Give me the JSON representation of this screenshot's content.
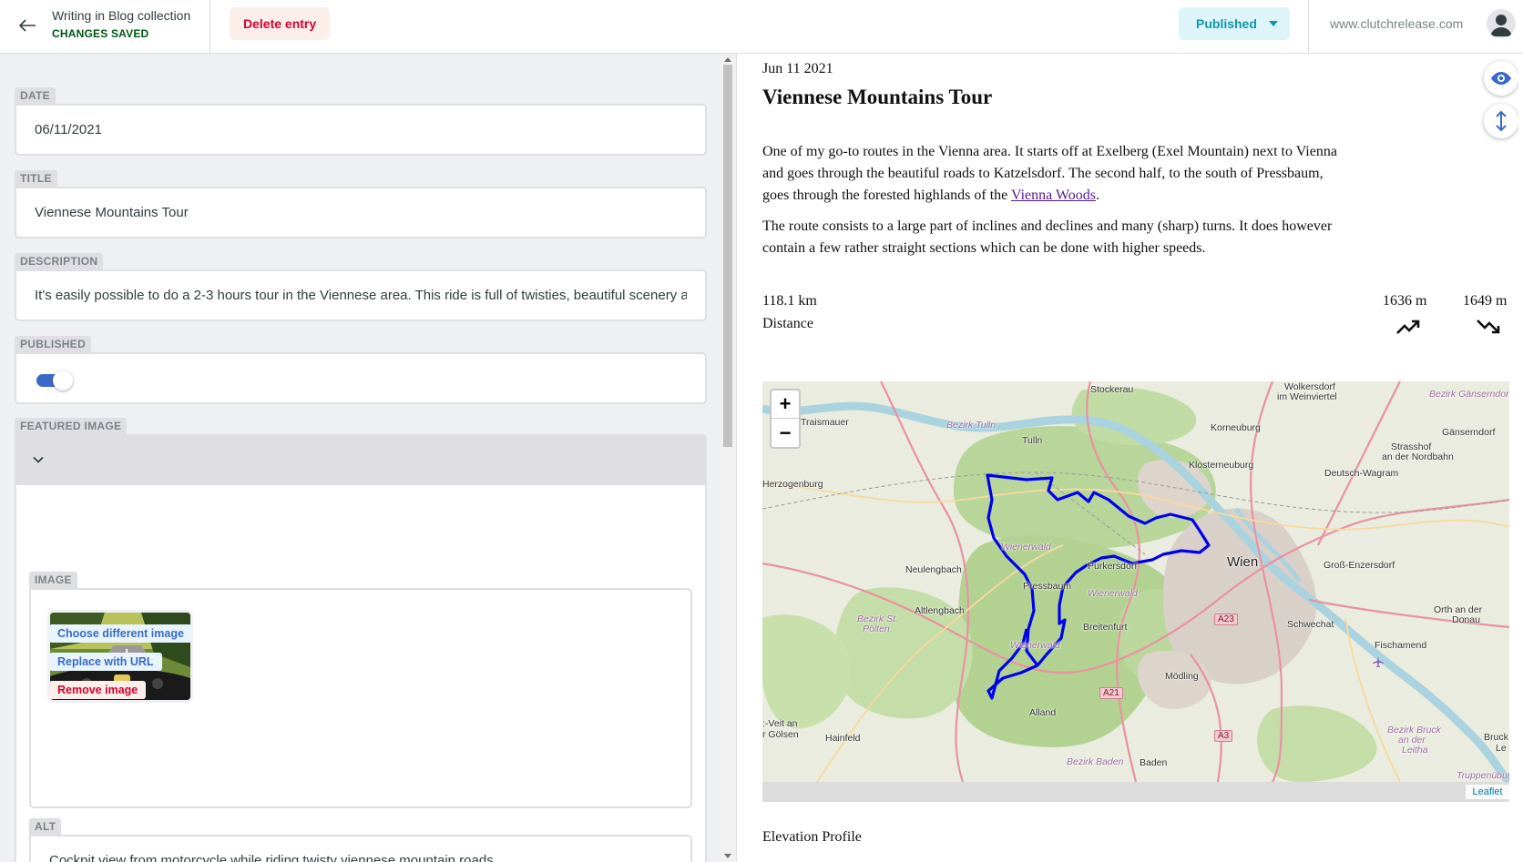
{
  "header": {
    "collection_title": "Writing in Blog collection",
    "save_status": "CHANGES SAVED",
    "delete_label": "Delete entry",
    "status_label": "Published",
    "site_url": "www.clutchrelease.com"
  },
  "fields": {
    "date": {
      "label": "DATE",
      "value": "06/11/2021"
    },
    "title": {
      "label": "TITLE",
      "value": "Viennese Mountains Tour"
    },
    "description": {
      "label": "DESCRIPTION",
      "value": "It's easily possible to do a 2-3 hours tour in the Viennese area. This ride is full of twisties, beautiful scenery a"
    },
    "published": {
      "label": "PUBLISHED",
      "checked": true
    },
    "featured_image": {
      "label": "FEATURED IMAGE",
      "image": {
        "label": "IMAGE",
        "choose_label": "Choose different image",
        "replace_label": "Replace with URL",
        "remove_label": "Remove image"
      },
      "alt": {
        "label": "ALT",
        "value": "Cockpit view from motorcycle while riding twisty viennese mountain roads"
      }
    }
  },
  "preview": {
    "date": "Jun 11 2021",
    "title": "Viennese Mountains Tour",
    "paragraph1": {
      "before": "One of my go-to routes in the Vienna area. It starts off at Exelberg (Exel Mountain) next to Vienna and goes through the beautiful roads to Katzelsdorf. The second half, to the south of Pressbaum, goes through the forested highlands of the ",
      "link": "Vienna Woods",
      "after": "."
    },
    "paragraph2": "The route consists to a large part of inclines and declines and many (sharp) turns. It does however contain a few rather straight sections which can be done with higher speeds.",
    "stats": {
      "distance_value": "118.1 km",
      "distance_label": "Distance",
      "ascent_value": "1636 m",
      "descent_value": "1649 m"
    },
    "map": {
      "zoom_in": "+",
      "zoom_out": "−",
      "attribution": "Leaflet",
      "labels": {
        "stockerau": "Stockerau",
        "wolkersdorf": "Wolkersdorf",
        "im_weinviertel": "im Weinviertel",
        "bezirk_gaenserndorf": "Bezirk Gänserndorf",
        "traismauer": "Traismauer",
        "bezirk_tulln": "Bezirk Tulln",
        "tulln": "Tulln",
        "korneuburg": "Korneuburg",
        "gaenserndorf": "Gänserndorf",
        "strasshof": "Strasshof",
        "an_der_nordbahn": "an der Nordbahn",
        "klosterneuburg": "Klosterneuburg",
        "deutsch_wagram": "Deutsch-Wagram",
        "herzogenburg": "Herzogenburg",
        "wienerwald1": "Wienerwald",
        "purkersdorf": "Purkersdorf",
        "wien": "Wien",
        "neulengbach": "Neulengbach",
        "gross_enzersdorf": "Groß-Enzersdorf",
        "pressbaum": "Pressbaum",
        "wienerwald2": "Wienerwald",
        "altlengbach": "Altlengbach",
        "bezirk_st": "Bezirk St.",
        "poelten": "Pölten",
        "breitenfurt": "Breitenfurt",
        "orth_an_der": "Orth an der",
        "donau": "Donau",
        "schwechat": "Schwechat",
        "wienerwald3": "Wienerwald",
        "fischamend": "Fischamend",
        "moedling": "Mödling",
        "alland": "Alland",
        "veit_an": ":-Veit an",
        "golsen": "r Gölsen",
        "hainfeld": "Hainfeld",
        "bezirk_bruck": "Bezirk Bruck",
        "an_der": "an der",
        "leitha": "Leitha",
        "bruck": "Bruck",
        "le": "Le",
        "bezirk_baden": "Bezirk Baden",
        "baden": "Baden",
        "truppenuebung": "Truppenübun"
      },
      "roads": {
        "a23": "A23",
        "a21": "A21",
        "a3": "A3"
      },
      "route_color": "#0000ee"
    },
    "elevation_title": "Elevation Profile"
  },
  "colors": {
    "accent_blue": "#3a69c7",
    "save_green": "#005614",
    "danger_red": "#d60032",
    "published_teal": "#1195aa"
  },
  "icons": {
    "back": "arrow-left-icon",
    "avatar": "user-avatar-icon",
    "caret": "caret-down-icon",
    "chevron": "chevron-down-icon",
    "eye": "eye-icon",
    "scroll_sync": "scroll-sync-icon",
    "ascent": "trending-up-icon",
    "descent": "trending-down-icon"
  }
}
